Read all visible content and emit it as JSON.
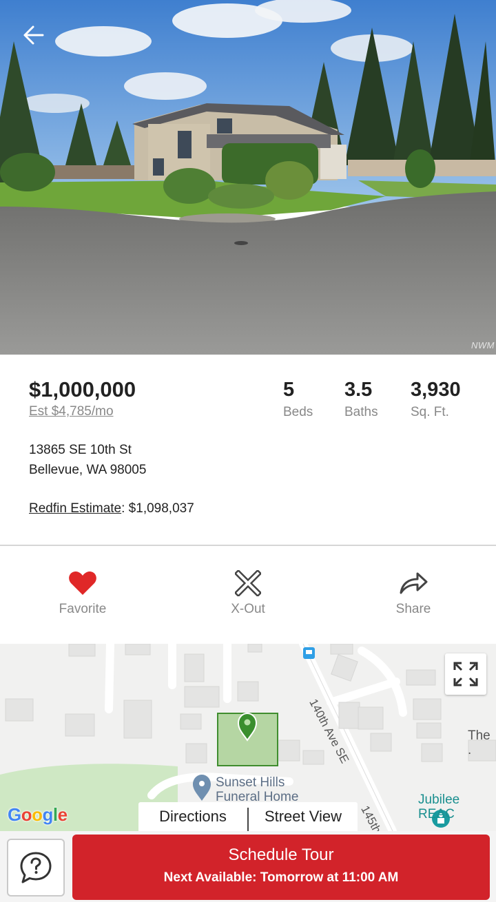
{
  "hero": {
    "watermark": "NWM",
    "back_icon": "arrow-left-icon"
  },
  "summary": {
    "price": "$1,000,000",
    "est_monthly": "Est $4,785/mo",
    "beds_value": "5",
    "beds_label": "Beds",
    "baths_value": "3.5",
    "baths_label": "Baths",
    "sqft_value": "3,930",
    "sqft_label": "Sq. Ft.",
    "address_line1": "13865 SE 10th St",
    "address_line2": "Bellevue, WA 98005",
    "estimate_label": "Redfin Estimate",
    "estimate_value": ": $1,098,037"
  },
  "actions": {
    "favorite_label": "Favorite",
    "xout_label": "X-Out",
    "share_label": "Share"
  },
  "map": {
    "poi_line1": "Sunset Hills",
    "poi_line2": "Funeral Home",
    "place_the": "The .",
    "place_jubilee": "Jubilee REAC",
    "street_140": "140th Ave SE",
    "street_145": "145th",
    "google": "Google",
    "directions_label": "Directions",
    "street_view_label": "Street View"
  },
  "bottom": {
    "tour_title": "Schedule Tour",
    "tour_subtitle": "Next Available: Tomorrow at 11:00 AM"
  },
  "colors": {
    "brand_red": "#d2232a",
    "favorite_red": "#e02828",
    "pin_green": "#3a8f2e",
    "parcel_green": "#b5d6a3"
  }
}
